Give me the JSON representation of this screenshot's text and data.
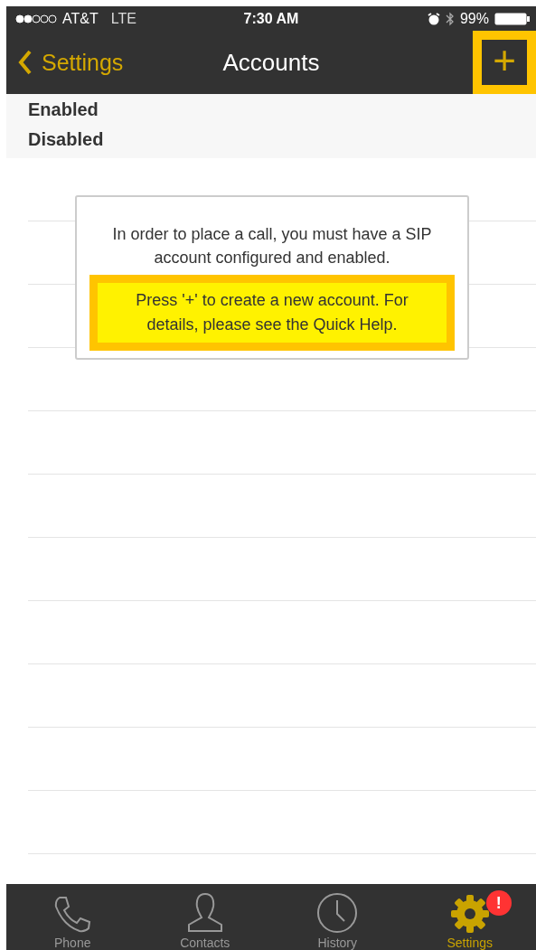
{
  "status_bar": {
    "signal_dots": [
      {
        "filled": true
      },
      {
        "filled": true
      },
      {
        "filled": false
      },
      {
        "filled": false
      },
      {
        "filled": false
      }
    ],
    "carrier": "AT&T",
    "network": "LTE",
    "time": "7:30 AM",
    "battery": "99%"
  },
  "nav": {
    "back": "Settings",
    "title": "Accounts",
    "add": "+"
  },
  "sections": [
    "Enabled",
    "Disabled"
  ],
  "notice": {
    "message": "In order to place a call, you must have a SIP account configured and enabled.",
    "hint": "Press '+' to create a new account. For details, please see the Quick Help."
  },
  "tabs": [
    {
      "label": "Phone",
      "kind": "phone",
      "selected": false
    },
    {
      "label": "Contacts",
      "kind": "contacts",
      "selected": false
    },
    {
      "label": "History",
      "kind": "history",
      "selected": false
    },
    {
      "label": "Settings",
      "kind": "settings",
      "selected": true,
      "badge": "!"
    }
  ]
}
